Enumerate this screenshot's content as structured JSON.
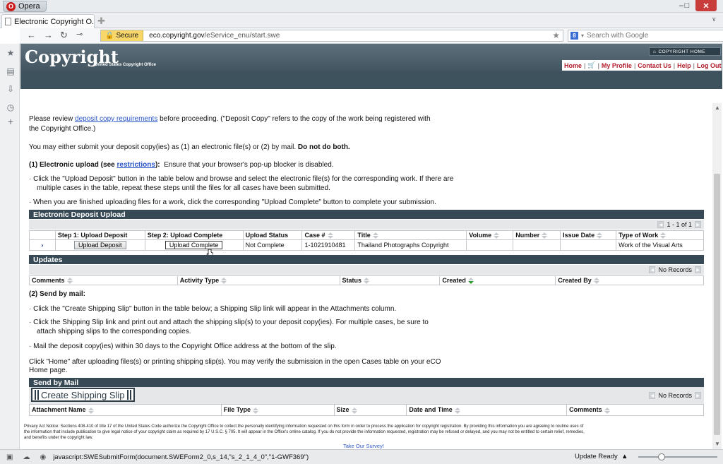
{
  "browser": {
    "app_name": "Opera",
    "tab_title": "Electronic Copyright O...",
    "secure_label": "Secure",
    "url_host": "eco.copyright.gov",
    "url_path": "/eService_enu/start.swe",
    "search_placeholder": "Search with Google",
    "status_text": "javascript:SWESubmitForm(document.SWEForm2_0,s_14,\"s_2_1_4_0\",\"1-GWF369\")",
    "status_right": "Update Ready"
  },
  "site": {
    "logo_text": "Copyright",
    "logo_sub": "United States Copyright Office",
    "copyright_home": "COPYRIGHT HOME",
    "nav": [
      "Home",
      "My Profile",
      "Contact Us",
      "Help",
      "Log Out"
    ]
  },
  "intro": {
    "line1_pre": "Please review ",
    "line1_link": "deposit copy requirements",
    "line1_post": " before proceeding. (\"Deposit Copy\" refers to the copy of the work being registered with",
    "line2": "the Copyright Office.)",
    "line3_pre": "You may either submit your deposit copy(ies) as (1) an electronic file(s) or (2) by mail. ",
    "line3_bold": "Do not do both.",
    "sec1_pre": "(1) Electronic upload (see ",
    "sec1_link": "restrictions",
    "sec1_post": "):",
    "sec1_note": "Ensure that your browser's pop-up blocker is disabled.",
    "b1a": "· Click the \"Upload Deposit\" button in the table below and browse and select the electronic file(s) for the corresponding work. If there are",
    "b1b": "multiple cases in the table, repeat these steps until the files for all cases have been submitted.",
    "b2": "·  When you are finished uploading files for a work, click the corresponding \"Upload Complete\" button to complete your submission."
  },
  "upload_table": {
    "title": "Electronic Deposit Upload",
    "pager": "1 - 1 of 1",
    "headers": [
      "Step 1: Upload Deposit",
      "Step 2: Upload Complete",
      "Upload Status",
      "Case #",
      "Title",
      "Volume",
      "Number",
      "Issue Date",
      "Type of Work"
    ],
    "row": {
      "upload_deposit": "Upload Deposit",
      "upload_complete": "Upload Complete",
      "status": "Not Complete",
      "case": "1-1021910481",
      "title": "Thailand Photographs Copyright",
      "volume": "",
      "number": "",
      "issue_date": "",
      "type": "Work of the Visual Arts"
    }
  },
  "updates_table": {
    "title": "Updates",
    "pager": "No Records",
    "headers": [
      "Comments",
      "Activity Type",
      "Status",
      "Created",
      "Created By"
    ]
  },
  "mail": {
    "heading": "(2) Send by mail:",
    "b1": "· Click the \"Create Shipping Slip\" button in the table below; a Shipping Slip link will appear in the Attachments column.",
    "b2a": "· Click the Shipping Slip link and print out and attach the shipping slip(s) to your deposit copy(ies). For multiple cases, be sure to",
    "b2b": "attach shipping slips to the corresponding copies.",
    "b3": "· Mail the deposit copy(ies) within 30 days to the Copyright Office address at the bottom of the slip.",
    "home1": "Click \"Home\" after uploading files(s) or printing shipping slip(s). You may verify the submission in the open Cases table on your eCO",
    "home2": "Home page."
  },
  "mail_table": {
    "title": "Send by Mail",
    "button": "Create Shipping Slip",
    "pager": "No Records",
    "headers": [
      "Attachment Name",
      "File Type",
      "Size",
      "Date and Time",
      "Comments"
    ]
  },
  "footer": {
    "privacy1": "Privacy Act Notice: Sections 408-410 of title 17 of the United States Code authorize the Copyright Office to collect the personally identifying information requested on this form in order to process the application for copyright registration. By providing this information you are agreeing to routine uses of",
    "privacy2": "the information that include publication to give legal notice of your copyright claim as required by 17 U.S.C. § 705. It will appear in the Office's online catalog. If you do not provide the information requested, registration may be refused or delayed, and you may not be entitled to certain relief, remedies,",
    "privacy3": "and benefits under the copyright law.",
    "survey": "Take Our Survey!"
  }
}
